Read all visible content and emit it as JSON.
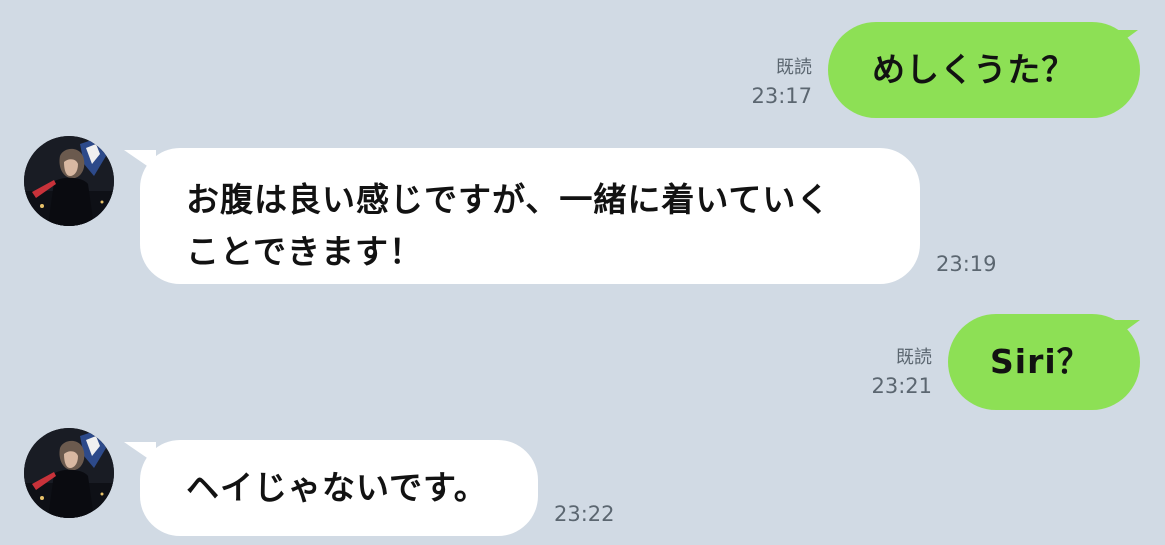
{
  "chat": {
    "messages": [
      {
        "side": "sent",
        "text": "めしくうた？",
        "read": "既読",
        "time": "23:17"
      },
      {
        "side": "received",
        "text_lines": [
          "お腹は良い感じですが、一緒に着いていく",
          "ことできます！"
        ],
        "time": "23:19"
      },
      {
        "side": "sent",
        "text": "Siri？",
        "read": "既読",
        "time": "23:21"
      },
      {
        "side": "received",
        "text": "ヘイじゃないです。",
        "time": "23:22"
      }
    ]
  },
  "colors": {
    "background": "#d1dae4",
    "sent_bubble": "#8de055",
    "received_bubble": "#ffffff",
    "meta_text": "#5b6670"
  },
  "icons": {
    "avatar": "user-avatar-photo"
  }
}
